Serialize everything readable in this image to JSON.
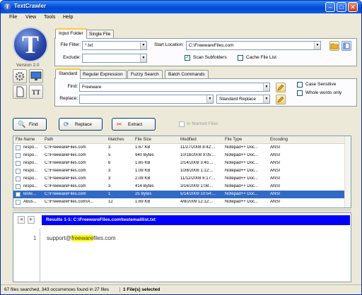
{
  "window": {
    "title": "TextCrawler",
    "icon": "T"
  },
  "menu": [
    "File",
    "View",
    "Tools",
    "Help"
  ],
  "logo": {
    "letter": "T",
    "version": "Version 2.0"
  },
  "top_tabs": [
    "Input Folder",
    "Single File"
  ],
  "input": {
    "file_filter_label": "File Filter:",
    "file_filter_value": "*.txt",
    "start_location_label": "Start Location:",
    "start_location_value": "C:\\FreewareFiles.com",
    "exclude_label": "Exclude:",
    "exclude_value": "",
    "scan_subfolders_label": "Scan Subfolders",
    "scan_subfolders_checked": true,
    "cache_file_list_label": "Cache File List",
    "cache_file_list_checked": false
  },
  "search_tabs": [
    "Standard",
    "Regular Expression",
    "Fuzzy Search",
    "Batch Commands"
  ],
  "search": {
    "find_label": "Find:",
    "find_value": "Freeware",
    "replace_label": "Replace:",
    "replace_value": "",
    "replace_mode": "Standard Replace",
    "case_sensitive_label": "Case Sensitive",
    "whole_words_label": "Whole words only"
  },
  "actions": {
    "find_label": "Find",
    "replace_label": "Replace",
    "extract_label": "Extract",
    "in_marked_files_label": "In Marked Files"
  },
  "grid": {
    "headers": [
      "File Name",
      "Path",
      "Matches",
      "File Size",
      "Modified",
      "File Type",
      "Encoding"
    ],
    "rows": [
      [
        "respo...",
        "C:\\FreewareFiles.com",
        "3",
        "1.67 KB",
        "11/27/2008 8:42:...",
        "Notepad++ Doc...",
        "ANSI"
      ],
      [
        "respo...",
        "C:\\FreewareFiles.com",
        "5",
        "940 Bytes",
        "10/18/2008 9:05:...",
        "Notepad++ Doc...",
        "ANSI"
      ],
      [
        "respo...",
        "C:\\FreewareFiles.com",
        "6",
        "1.65 KB",
        "2/14/2008 3:45:...",
        "Notepad++ Doc...",
        "ANSI"
      ],
      [
        "respo...",
        "C:\\FreewareFiles.com",
        "3",
        "1.08 KB",
        "10/8/2008 1:12:...",
        "Notepad++ Doc...",
        "ANSI"
      ],
      [
        "respo...",
        "C:\\FreewareFiles.com",
        "3",
        "2.08 KB",
        "11/12/2008 6:17:...",
        "Notepad++ Doc...",
        "ANSI"
      ],
      [
        "respo...",
        "C:\\FreewareFiles.com",
        "3",
        "414 Bytes",
        "3/16/2009 1:08:...",
        "Notepad++ Doc...",
        "ANSI"
      ],
      [
        "teste...",
        "C:\\FreewareFiles.com",
        "1",
        "25 Bytes",
        "5/14/2009 10:54:...",
        "Notepad++ Doc...",
        "ANSI"
      ],
      [
        "Abus...",
        "C:\\FreewareFiles.com\\A...",
        "12",
        "1.69 KB",
        "4/8/2009 12:12:...",
        "Notepad++ Doc...",
        "ANSI"
      ]
    ],
    "selected_row": 6
  },
  "preview": {
    "result_header": "Results 1-1: C:\\FreewareFiles.com\\testemaillist.txt",
    "line_number": "1",
    "line_before": "support@",
    "line_match": "freeware",
    "line_after": "files.com"
  },
  "status": {
    "summary": "67 files searched, 343 occurrences found in 27 files",
    "selection": "1 File(s) selected"
  },
  "colors": {
    "titlebar": "#0a58e0",
    "selection": "#316ac5",
    "result_bar": "#0000ff",
    "highlight": "#ffff00"
  }
}
